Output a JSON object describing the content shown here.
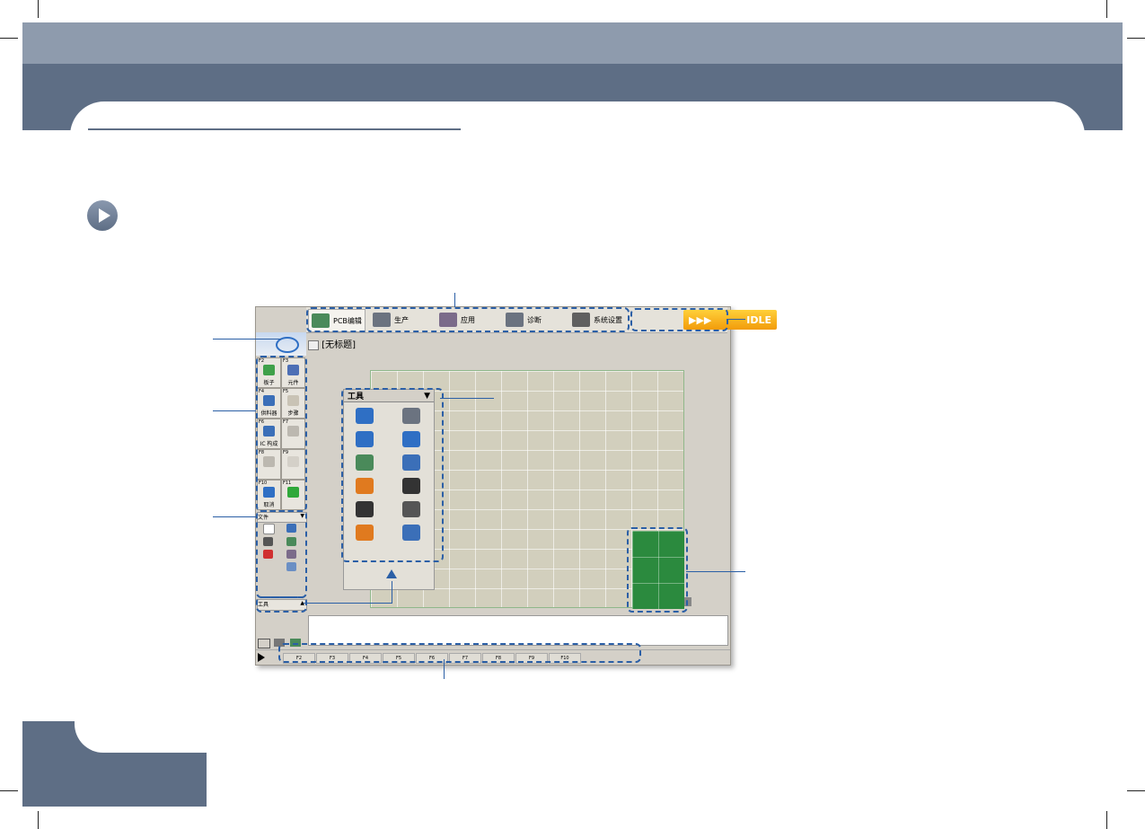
{
  "window": {
    "tabs": [
      {
        "label": "PCB编辑",
        "icon": "pcb-edit-icon",
        "color": "#4a8a5a"
      },
      {
        "label": "生产",
        "icon": "production-icon",
        "color": "#6b7380"
      },
      {
        "label": "应用",
        "icon": "application-icon",
        "color": "#7b6b8a"
      },
      {
        "label": "诊断",
        "icon": "diagnosis-icon",
        "color": "#6b7380"
      },
      {
        "label": "系统设置",
        "icon": "system-settings-icon",
        "color": "#606060"
      }
    ],
    "status": {
      "arrows": "▶▶▶",
      "label": "IDLE",
      "color": "#f5a612"
    },
    "document_title": "[无标题]",
    "fkeys": [
      {
        "key": "F2",
        "label": "板子",
        "icon": "board-icon",
        "color": "#3fa14a"
      },
      {
        "key": "F3",
        "label": "元件",
        "icon": "component-icon",
        "color": "#4d6fb5"
      },
      {
        "key": "F4",
        "label": "供料器",
        "icon": "feeder-icon",
        "color": "#3b6fb8"
      },
      {
        "key": "F5",
        "label": "步骤",
        "icon": "step-icon",
        "color": "#c9c3b5"
      },
      {
        "key": "F6",
        "label": "IC 构成",
        "icon": "ic-config-icon",
        "color": "#3b6fb8"
      },
      {
        "key": "F7",
        "label": "",
        "icon": "search-disabled-icon",
        "color": "#bcb8b0"
      },
      {
        "key": "F8",
        "label": "",
        "icon": "person-disabled-icon",
        "color": "#bcb8b0"
      },
      {
        "key": "F9",
        "label": "",
        "icon": "blank-icon",
        "color": "#d4d0c8"
      },
      {
        "key": "F10",
        "label": "取消",
        "icon": "cancel-icon",
        "color": "#2f6fc4"
      },
      {
        "key": "F11",
        "label": "",
        "icon": "screen-icon",
        "color": "#2fa83a"
      }
    ],
    "file_panel": {
      "label": "文件",
      "arrow": "▼"
    },
    "tools_small_panel": {
      "label": "工具",
      "arrow": "▲"
    },
    "tool_palette": {
      "label": "工具",
      "arrow": "▼",
      "items": [
        {
          "icon": "home-icon",
          "color": "#2f6fc4"
        },
        {
          "icon": "window-icon",
          "color": "#6b7380"
        },
        {
          "icon": "up-arrow-icon",
          "color": "#2f6fc4"
        },
        {
          "icon": "operator-icon",
          "color": "#2f6fc4"
        },
        {
          "icon": "conveyor-icon",
          "color": "#4a8a5a"
        },
        {
          "icon": "axis-icon",
          "color": "#3b6fb8"
        },
        {
          "icon": "nozzle-icon",
          "color": "#e07a1f"
        },
        {
          "icon": "warning-icon",
          "color": "#333333"
        },
        {
          "icon": "auto-icon",
          "color": "#333333"
        },
        {
          "icon": "camera-icon",
          "color": "#555555"
        },
        {
          "icon": "settings-tool-icon",
          "color": "#e07a1f"
        },
        {
          "icon": "list-icon",
          "color": "#3b6fb8"
        }
      ]
    },
    "function_slots": [
      "F2",
      "F3",
      "F4",
      "F5",
      "F6",
      "F7",
      "F8",
      "F9",
      "F10"
    ],
    "board_color": "#2b8a3e"
  },
  "accent": "#2b5fa6"
}
